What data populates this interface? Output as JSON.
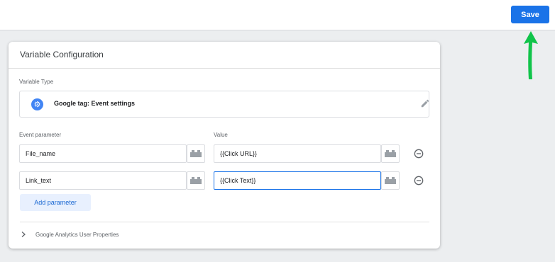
{
  "header": {
    "save_label": "Save"
  },
  "card": {
    "title": "Variable Configuration",
    "variable_type_label": "Variable Type",
    "variable_type_name": "Google tag: Event settings",
    "variable_type_icon": "gear-icon",
    "event_parameter_label": "Event parameter",
    "value_label": "Value",
    "rows": [
      {
        "parameter": "File_name",
        "value": "{{Click URL}}"
      },
      {
        "parameter": "Link_text",
        "value": "{{Click Text}}"
      }
    ],
    "add_parameter_label": "Add parameter",
    "ga_user_properties_label": "Google Analytics User Properties"
  },
  "colors": {
    "accent": "#1a73e8",
    "arrow": "#1db954"
  }
}
